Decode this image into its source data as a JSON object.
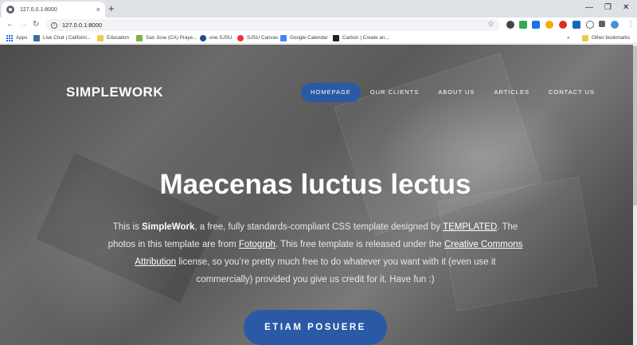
{
  "browser": {
    "tab_title": "127.0.0.1:8000",
    "tab_close": "×",
    "new_tab": "+",
    "url": "127.0.0.1:8000",
    "nav_back": "←",
    "nav_forward": "→",
    "nav_reload": "↻",
    "info_glyph": "i",
    "star_glyph": "☆",
    "menu_glyph": "⋮",
    "window_controls": {
      "minimize": "—",
      "maximize": "❐",
      "close": "✕"
    }
  },
  "bookmarks": {
    "items": [
      {
        "label": "Apps",
        "icon": "apps-icon"
      },
      {
        "label": "Live Chat | Californi...",
        "icon": "chat-icon",
        "color": "#3b6fa0"
      },
      {
        "label": "Education",
        "icon": "folder-icon",
        "color": "#f2c94c"
      },
      {
        "label": "San Jose (CA) Praye...",
        "icon": "prayer-icon",
        "color": "#7cb342"
      },
      {
        "label": "one.SJSU",
        "icon": "sjsu-icon",
        "color": "#1f4e8c"
      },
      {
        "label": "SJSU Canvas",
        "icon": "canvas-icon",
        "color": "#e53935"
      },
      {
        "label": "Google Calendar",
        "icon": "calendar-icon",
        "color": "#4285f4"
      },
      {
        "label": "Carbon | Create an...",
        "icon": "carbon-icon",
        "color": "#222222"
      }
    ],
    "more": "»",
    "other": "Other bookmarks"
  },
  "site": {
    "brand": "SIMPLEWORK",
    "nav": [
      "HOMEPAGE",
      "OUR CLIENTS",
      "ABOUT US",
      "ARTICLES",
      "CONTACT US"
    ],
    "active_nav": "HOMEPAGE",
    "hero_title": "Maecenas luctus lectus",
    "hero_text": {
      "p1": "This is ",
      "brand": "SimpleWork",
      "p2": ", a free, fully standards-compliant CSS template designed by ",
      "link1": "TEMPLATED",
      "p3": ". The photos in this template are from ",
      "link2": "Fotogrph",
      "p4": ". This free template is released under the ",
      "link3": "Creative Commons Attribution",
      "p5": " license, so you’re pretty much free to do whatever you want with it (even use it commercially) provided you give us credit for it. Have fun :)"
    },
    "button": "ETIAM POSUERE"
  },
  "colors": {
    "accent": "#2a5aa5"
  }
}
